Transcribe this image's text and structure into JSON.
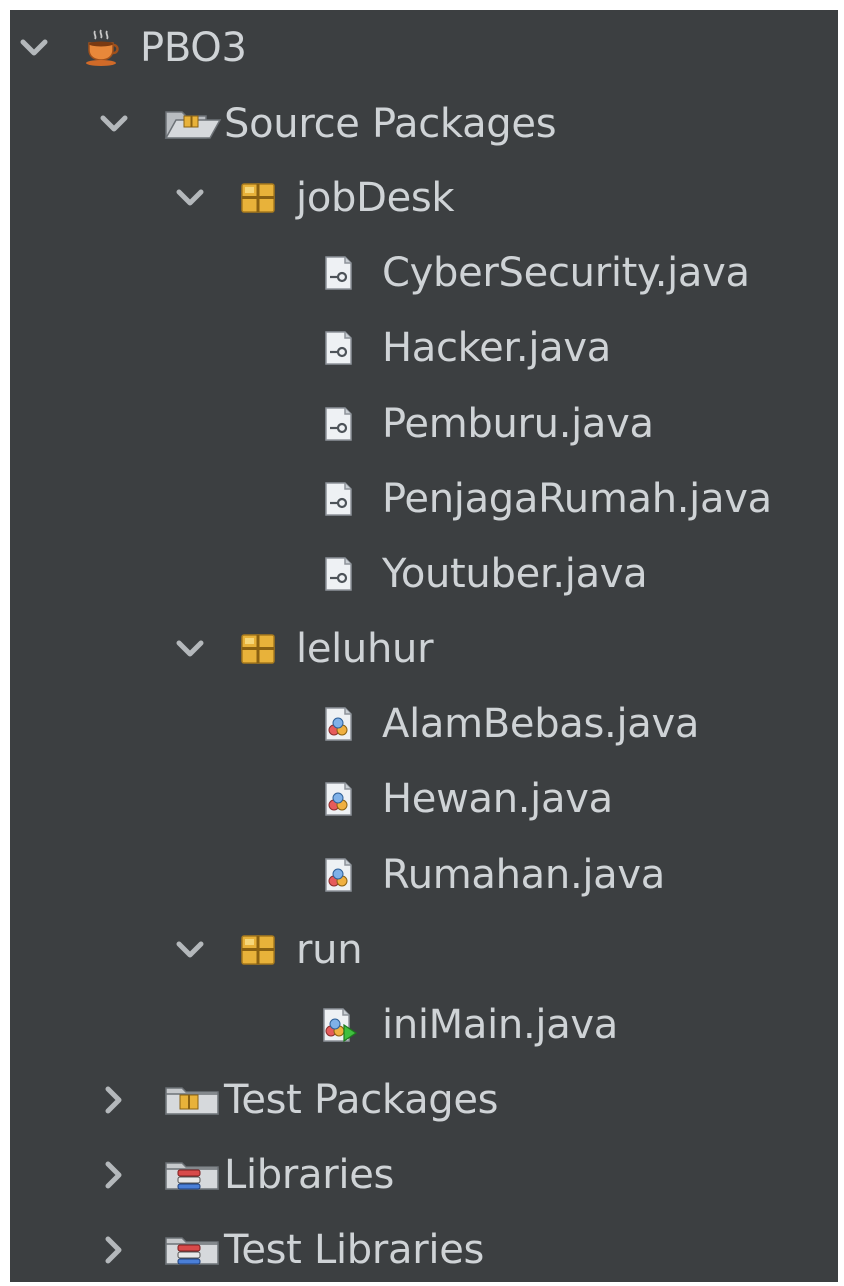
{
  "tree": {
    "project": {
      "label": "PBO3",
      "expanded": true,
      "icon": "coffee-cup-icon"
    },
    "source_packages": {
      "label": "Source Packages",
      "expanded": true,
      "icon": "source-folder-open-icon",
      "packages": [
        {
          "label": "jobDesk",
          "expanded": true,
          "icon": "package-icon",
          "files": [
            {
              "label": "CyberSecurity.java",
              "icon": "interface-file-icon"
            },
            {
              "label": "Hacker.java",
              "icon": "interface-file-icon"
            },
            {
              "label": "Pemburu.java",
              "icon": "interface-file-icon"
            },
            {
              "label": "PenjagaRumah.java",
              "icon": "interface-file-icon"
            },
            {
              "label": "Youtuber.java",
              "icon": "interface-file-icon"
            }
          ]
        },
        {
          "label": "leluhur",
          "expanded": true,
          "icon": "package-icon",
          "files": [
            {
              "label": "AlamBebas.java",
              "icon": "class-file-icon"
            },
            {
              "label": "Hewan.java",
              "icon": "class-file-icon"
            },
            {
              "label": "Rumahan.java",
              "icon": "class-file-icon"
            }
          ]
        },
        {
          "label": "run",
          "expanded": true,
          "icon": "package-icon",
          "files": [
            {
              "label": "iniMain.java",
              "icon": "main-class-file-icon"
            }
          ]
        }
      ]
    },
    "test_packages": {
      "label": "Test Packages",
      "expanded": false,
      "icon": "test-folder-icon"
    },
    "libraries": {
      "label": "Libraries",
      "expanded": false,
      "icon": "library-folder-icon"
    },
    "test_libraries": {
      "label": "Test Libraries",
      "expanded": false,
      "icon": "library-folder-icon"
    }
  },
  "colors": {
    "panel_bg": "#3c3f41",
    "text": "#cfd3d6",
    "arrow": "#b4b8bb",
    "package_yellow": "#e8b23a"
  }
}
